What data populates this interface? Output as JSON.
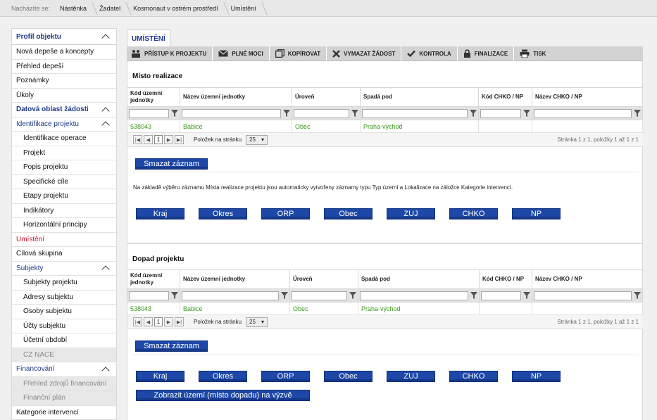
{
  "breadcrumb": {
    "label": "Nacházíte se:",
    "items": [
      "Nástěnka",
      "Žadatel",
      "Kosmonaut v ostrém prostředí",
      "Umístění"
    ]
  },
  "sidebar": {
    "items": [
      {
        "label": "Profil objektu",
        "type": "sec",
        "chev": true
      },
      {
        "label": "Nová depeše a koncepty",
        "type": "plain"
      },
      {
        "label": "Přehled depeší",
        "type": "plain"
      },
      {
        "label": "Poznámky",
        "type": "plain"
      },
      {
        "label": "Úkoly",
        "type": "plain"
      },
      {
        "label": "Datová oblast žádosti",
        "type": "sec",
        "chev": true
      },
      {
        "label": "Identifikace projektu",
        "type": "sub",
        "chev": true
      },
      {
        "label": "Identifikace operace",
        "type": "child"
      },
      {
        "label": "Projekt",
        "type": "child"
      },
      {
        "label": "Popis projektu",
        "type": "child"
      },
      {
        "label": "Specifické cíle",
        "type": "child"
      },
      {
        "label": "Etapy projektu",
        "type": "child"
      },
      {
        "label": "Indikátory",
        "type": "child"
      },
      {
        "label": "Horizontální principy",
        "type": "child"
      },
      {
        "label": "Umístění",
        "type": "cur"
      },
      {
        "label": "Cílová skupina",
        "type": "plain"
      },
      {
        "label": "Subjekty",
        "type": "sub",
        "chev": true
      },
      {
        "label": "Subjekty projektu",
        "type": "child"
      },
      {
        "label": "Adresy subjektu",
        "type": "child"
      },
      {
        "label": "Osoby subjektu",
        "type": "child"
      },
      {
        "label": "Účty subjektu",
        "type": "child"
      },
      {
        "label": "Účetní období",
        "type": "child"
      },
      {
        "label": "CZ NACE",
        "type": "dis"
      },
      {
        "label": "Financování",
        "type": "sub",
        "chev": true
      },
      {
        "label": "Přehled zdrojů financování",
        "type": "dis"
      },
      {
        "label": "Finanční plán",
        "type": "dis"
      },
      {
        "label": "Kategorie intervencí",
        "type": "plain"
      }
    ]
  },
  "tab": {
    "label": "UMÍSTĚNÍ"
  },
  "toolbar": {
    "access": "PŘÍSTUP K PROJEKTU",
    "proxy": "PLNÉ MOCI",
    "copy": "KOPÍROVAT",
    "delete": "VYMAZAT ŽÁDOST",
    "check": "KONTROLA",
    "finalize": "FINALIZACE",
    "print": "TISK"
  },
  "columns": [
    "Kód územní jednotky",
    "Název územní jednotky",
    "Úroveň",
    "Spadá pod",
    "Kód CHKO / NP",
    "Název CHKO / NP"
  ],
  "realizace": {
    "title": "Místo realizace",
    "row": [
      "538043",
      "Babice",
      "Obec",
      "Praha-východ",
      "",
      ""
    ]
  },
  "dopad": {
    "title": "Dopad projektu",
    "row": [
      "538043",
      "Babice",
      "Obec",
      "Praha-východ",
      "",
      ""
    ]
  },
  "pager": {
    "page": "1",
    "per_page_label": "Položek na stránku",
    "per_page": "25",
    "info": "Stránka 1 z 1, položky 1 až 1 z 1"
  },
  "buttons": {
    "delete": "Smazat záznam",
    "kraj": "Kraj",
    "okres": "Okres",
    "orp": "ORP",
    "obec": "Obec",
    "zuj": "ZUJ",
    "chko": "CHKO",
    "np": "NP",
    "show": "Zobrazit území (místo dopadu) na výzvě"
  },
  "note": "Na základě výběru záznamu Místa realizace projektu jsou automaticky vytvořeny záznamy typu Typ území a Lokalizace na záložce Kategorie intervencí."
}
